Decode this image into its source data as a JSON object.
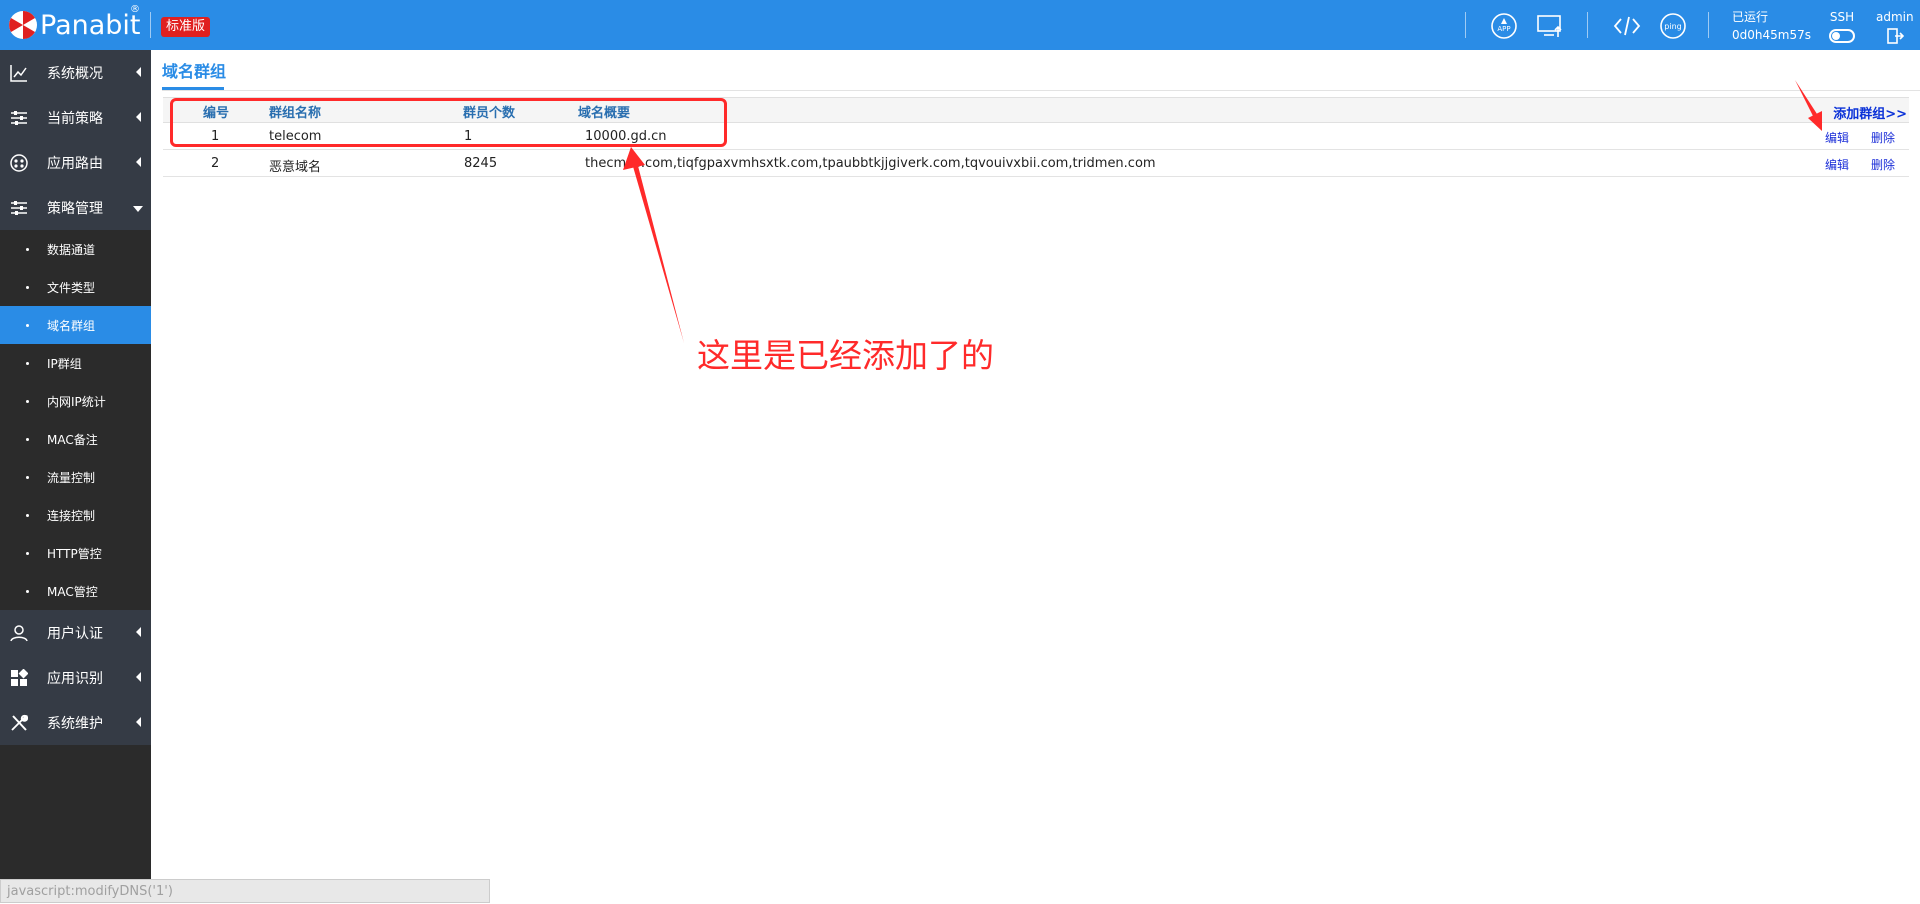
{
  "header": {
    "brand": "Panabit",
    "registered_mark": "®",
    "edition_badge": "标准版",
    "runtime_label": "已运行",
    "runtime_value": "0d0h45m57s",
    "ssh_label": "SSH",
    "user_label": "admin",
    "icons": [
      "app-icon",
      "monitor-upload-icon",
      "code-icon",
      "ping-icon",
      "logout-icon"
    ],
    "ping_text": "ping",
    "app_text": "APP"
  },
  "sidebar": {
    "items": [
      {
        "label": "系统概况",
        "icon": "chart-line-icon"
      },
      {
        "label": "当前策略",
        "icon": "sliders-icon"
      },
      {
        "label": "应用路由",
        "icon": "route-icon"
      },
      {
        "label": "策略管理",
        "icon": "sliders-icon",
        "expanded": true
      }
    ],
    "sub_items": [
      {
        "label": "数据通道"
      },
      {
        "label": "文件类型"
      },
      {
        "label": "域名群组",
        "active": true
      },
      {
        "label": "IP群组"
      },
      {
        "label": "内网IP统计"
      },
      {
        "label": "MAC备注"
      },
      {
        "label": "流量控制"
      },
      {
        "label": "连接控制"
      },
      {
        "label": "HTTP管控"
      },
      {
        "label": "MAC管控"
      }
    ],
    "bottom_items": [
      {
        "label": "用户认证",
        "icon": "user-icon"
      },
      {
        "label": "应用识别",
        "icon": "apps-icon"
      },
      {
        "label": "系统维护",
        "icon": "tools-icon"
      }
    ]
  },
  "status_bar": "javascript:modifyDNS('1')",
  "page": {
    "title": "域名群组",
    "add_group": "添加群组>>",
    "columns": [
      "编号",
      "群组名称",
      "群员个数",
      "域名概要"
    ],
    "rows": [
      {
        "id": "1",
        "name": "telecom",
        "count": "1",
        "summary": "10000.gd.cn",
        "edit": "编辑",
        "delete": "删除"
      },
      {
        "id": "2",
        "name": "恶意域名",
        "count": "8245",
        "summary": "thecmes.com,tiqfgpaxvmhsxtk.com,tpaubbtkjjgiverk.com,tqvouivxbii.com,tridmen.com",
        "edit": "编辑",
        "delete": "删除"
      }
    ]
  },
  "annotation": {
    "text": "这里是已经添加了的",
    "color": "#ff2a2a"
  },
  "colors": {
    "topbar": "#2a8ce6",
    "sidebar": "#2b2b2b",
    "active_item": "#2a8ce6",
    "link": "#1c2fd8"
  }
}
